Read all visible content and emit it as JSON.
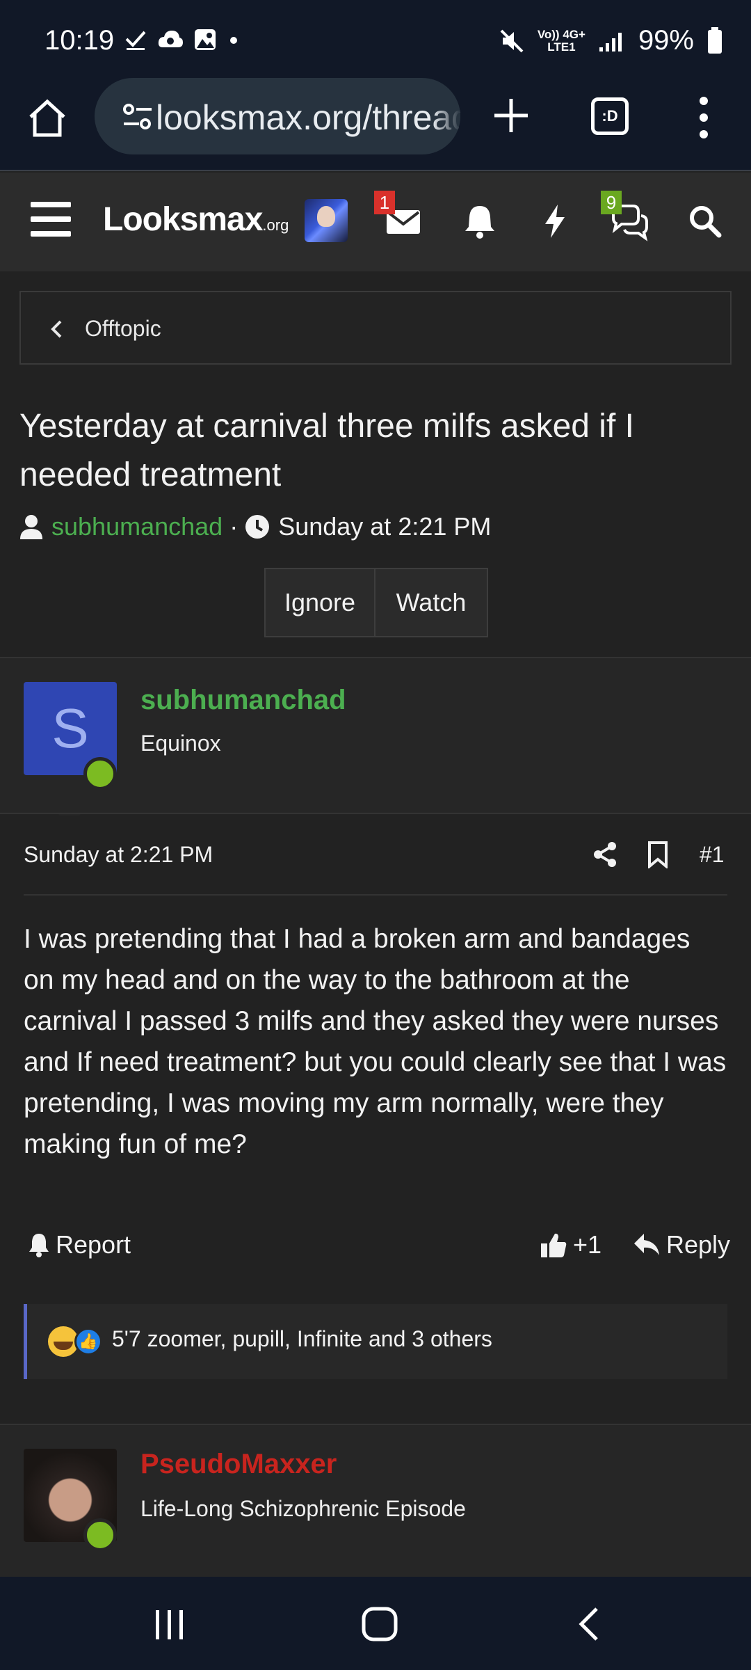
{
  "status_bar": {
    "time": "10:19",
    "net_top": "Vo)) 4G+",
    "net_bottom": "LTE1",
    "battery": "99%"
  },
  "browser": {
    "url": "looksmax.org/threads/yesterday-at-carnival",
    "tabs_label": ":D"
  },
  "header": {
    "logo_main": "Looksmax",
    "logo_suffix": ".org",
    "inbox_badge": "1",
    "conversations_badge": "9"
  },
  "breadcrumb": {
    "label": "Offtopic"
  },
  "thread": {
    "title": "Yesterday at carnival three milfs asked if I needed treatment",
    "author": "subhumanchad",
    "date": "Sunday at 2:21 PM",
    "ignore_label": "Ignore",
    "watch_label": "Watch"
  },
  "post1": {
    "avatar_letter": "S",
    "username": "subhumanchad",
    "user_title": "Equinox",
    "date": "Sunday at 2:21 PM",
    "number": "#1",
    "text": "I was pretending that I had a broken arm and bandages on my head and on the way to the bathroom at the carnival I passed 3 milfs and they asked they were nurses and If need treatment? but you could clearly see that I was pretending, I was moving my arm normally, were they making fun of me?",
    "report_label": "Report",
    "like_count": "+1",
    "reply_label": "Reply",
    "reactions_text": "5'7 zoomer, pupill, Infinite and 3 others"
  },
  "post2": {
    "username": "PseudoMaxxer",
    "user_title": "Life-Long Schizophrenic Episode"
  },
  "colors": {
    "accent_green": "#4caf50",
    "username_red": "#c8241e",
    "avatar_blue": "#2f46b3",
    "online_green": "#7cbb22"
  }
}
